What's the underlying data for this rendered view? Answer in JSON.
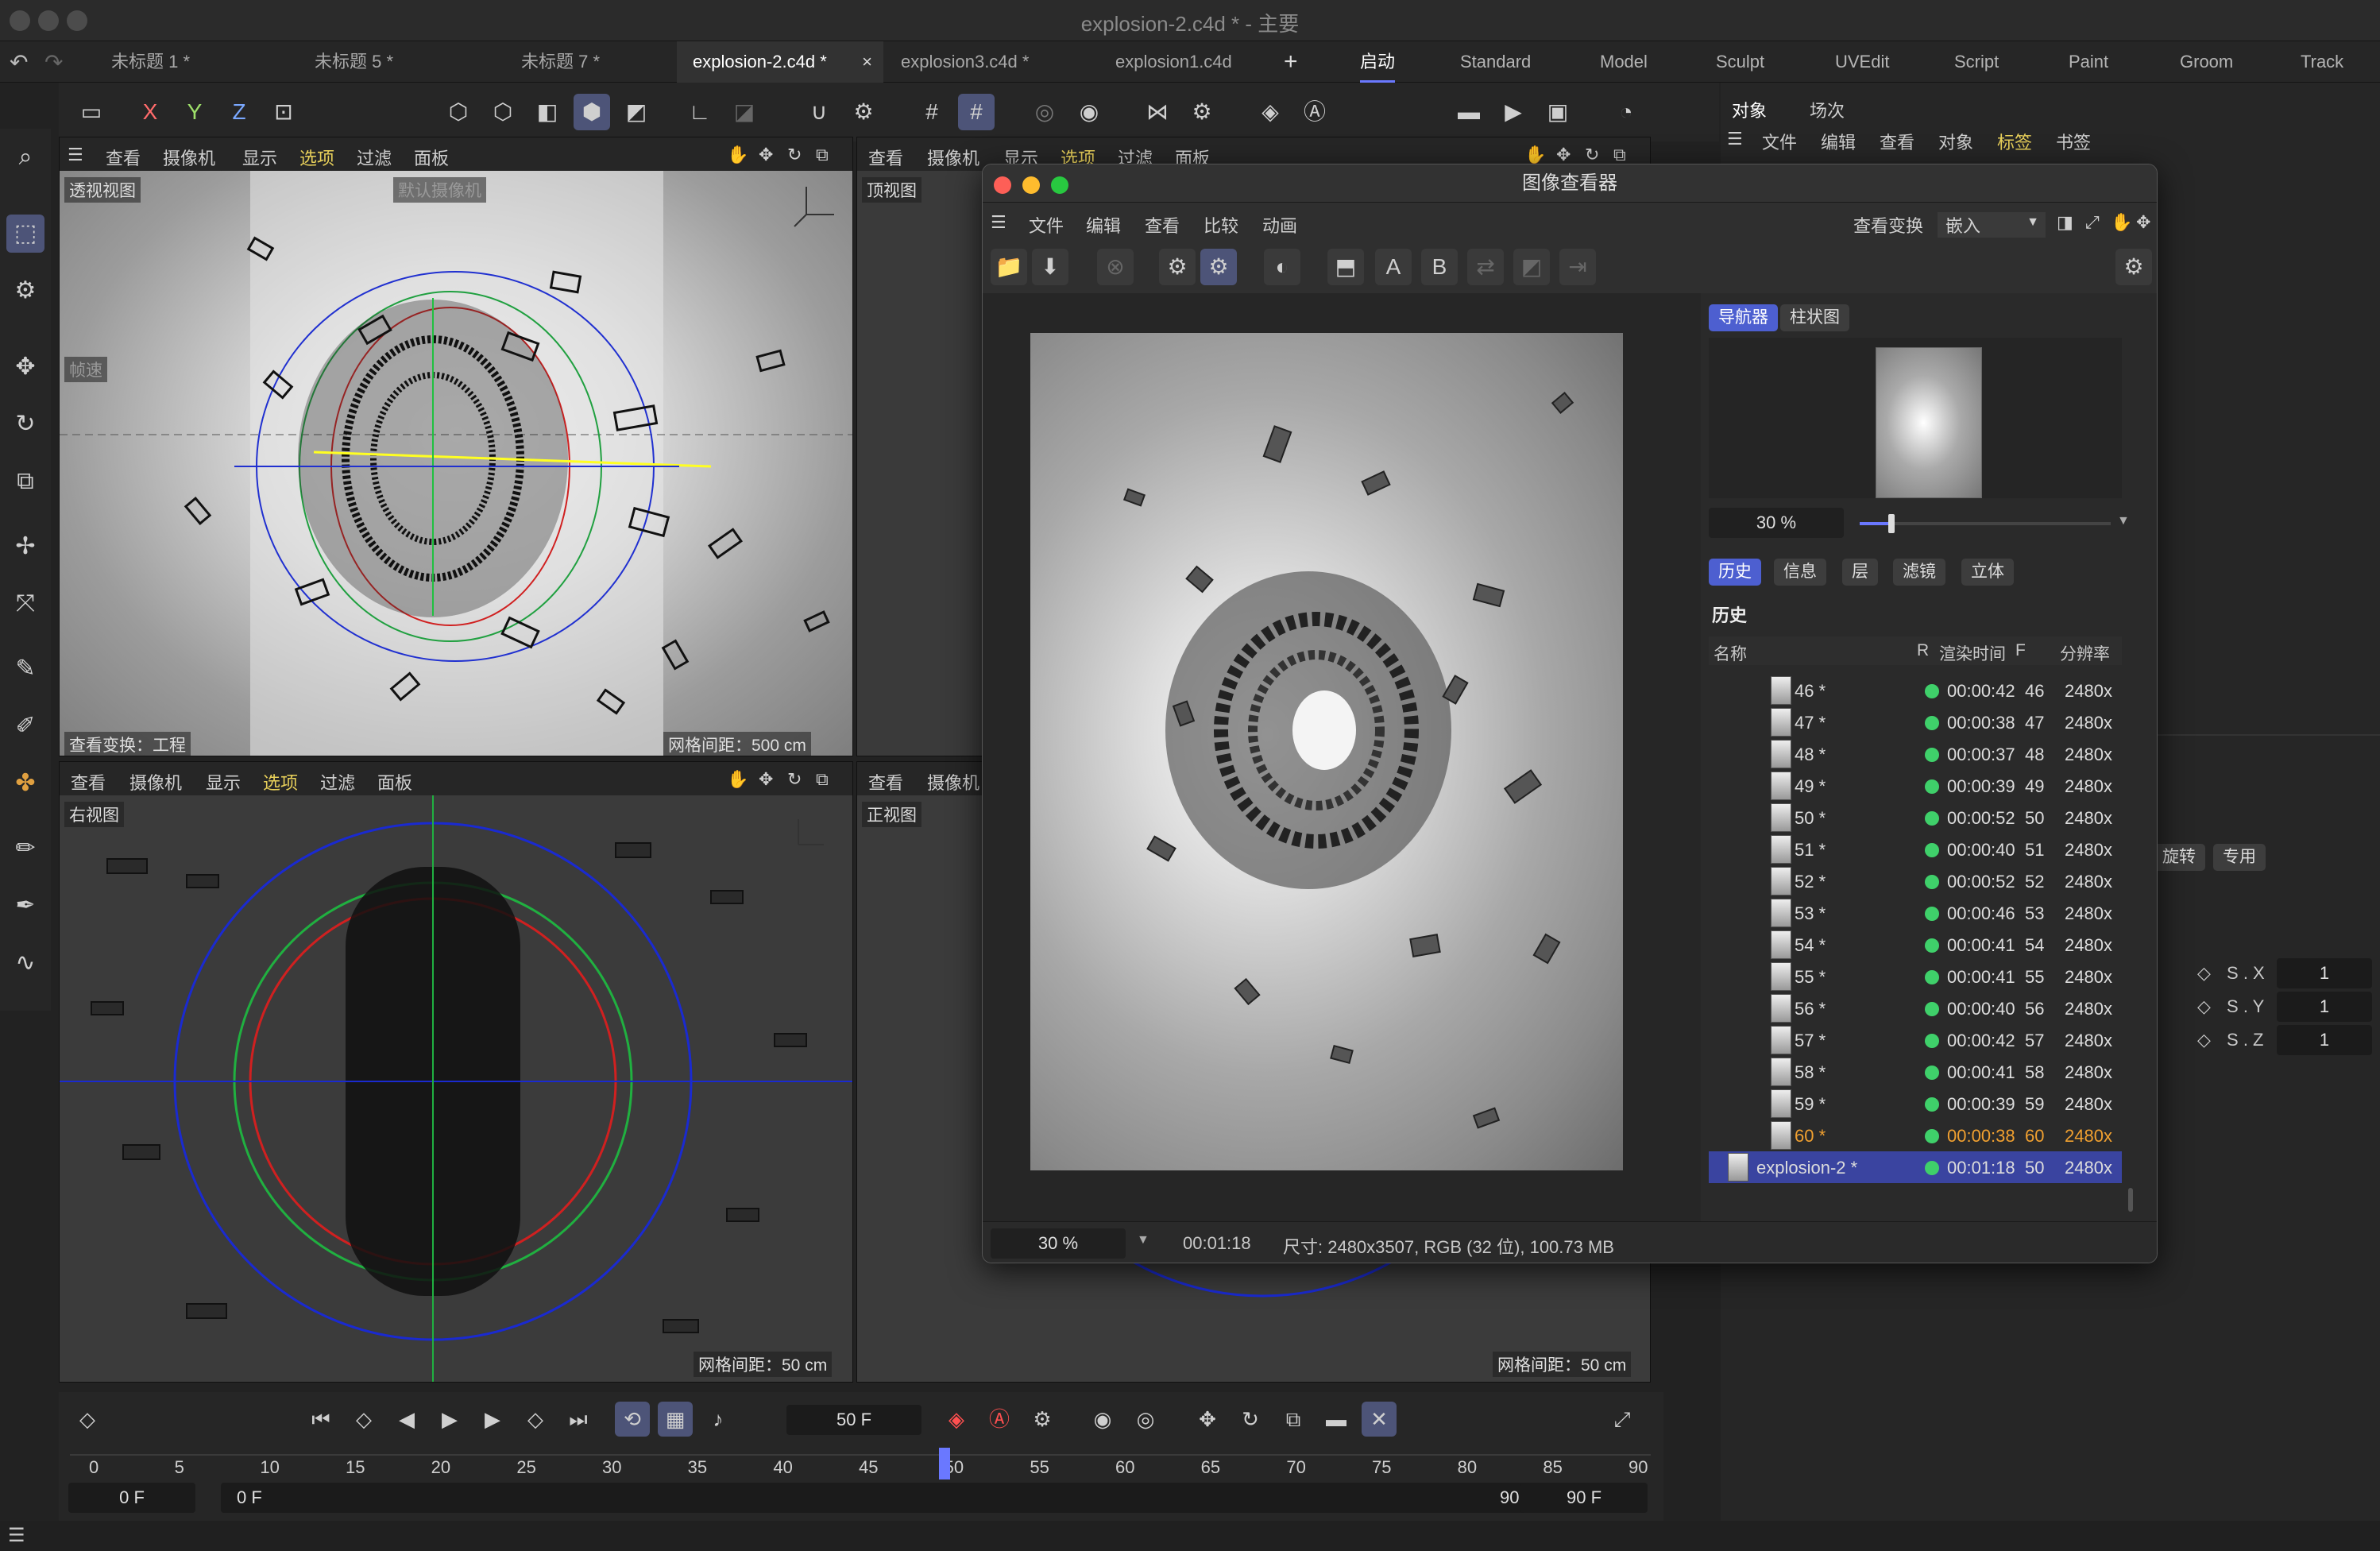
{
  "window": {
    "title": "explosion-2.c4d * - 主要"
  },
  "doc_tabs": [
    {
      "label": "未标题 1 *",
      "active": false
    },
    {
      "label": "未标题 5 *",
      "active": false
    },
    {
      "label": "未标题 7 *",
      "active": false
    },
    {
      "label": "explosion-2.c4d *",
      "active": true
    },
    {
      "label": "explosion3.c4d *",
      "active": false
    },
    {
      "label": "explosion1.c4d",
      "active": false
    }
  ],
  "layouts": [
    "启动",
    "Standard",
    "Model",
    "Sculpt",
    "UVEdit",
    "Script",
    "Paint",
    "Groom",
    "Track"
  ],
  "active_layout": "启动",
  "toolbar": {
    "x": "X",
    "y": "Y",
    "z": "Z"
  },
  "viewport_menu": {
    "view": "查看",
    "camera": "摄像机",
    "display": "显示",
    "options": "选项",
    "filter": "过滤",
    "panel": "面板"
  },
  "viewports": {
    "perspective": {
      "name": "透视视图",
      "cam": "默认摄像机",
      "view_transform": "查看变换：工程",
      "grid": "网格间距：500 cm",
      "hud": "帧速"
    },
    "top": {
      "name": "顶视图"
    },
    "right": {
      "name": "右视图",
      "grid": "网格间距：50 cm"
    },
    "front": {
      "name": "正视图",
      "grid": "网格间距：50 cm"
    }
  },
  "image_viewer": {
    "title": "图像查看器",
    "menus": [
      "文件",
      "编辑",
      "查看",
      "比较",
      "动画"
    ],
    "view_transform_label": "查看变换",
    "view_transform_value": "嵌入",
    "buttons": {
      "a": "A",
      "b": "B"
    },
    "nav_tabs": [
      "导航器",
      "柱状图"
    ],
    "zoom": "30 %",
    "sub_tabs": [
      "历史",
      "信息",
      "层",
      "滤镜",
      "立体"
    ],
    "history_title": "历史",
    "columns": {
      "name": "名称",
      "r": "R",
      "time": "渲染时间",
      "f": "F",
      "res": "分辨率"
    },
    "rows": [
      {
        "name": "46 *",
        "time": "00:00:42",
        "f": "46",
        "res": "2480x"
      },
      {
        "name": "47 *",
        "time": "00:00:38",
        "f": "47",
        "res": "2480x"
      },
      {
        "name": "48 *",
        "time": "00:00:37",
        "f": "48",
        "res": "2480x"
      },
      {
        "name": "49 *",
        "time": "00:00:39",
        "f": "49",
        "res": "2480x"
      },
      {
        "name": "50 *",
        "time": "00:00:52",
        "f": "50",
        "res": "2480x"
      },
      {
        "name": "51 *",
        "time": "00:00:40",
        "f": "51",
        "res": "2480x"
      },
      {
        "name": "52 *",
        "time": "00:00:52",
        "f": "52",
        "res": "2480x"
      },
      {
        "name": "53 *",
        "time": "00:00:46",
        "f": "53",
        "res": "2480x"
      },
      {
        "name": "54 *",
        "time": "00:00:41",
        "f": "54",
        "res": "2480x"
      },
      {
        "name": "55 *",
        "time": "00:00:41",
        "f": "55",
        "res": "2480x"
      },
      {
        "name": "56 *",
        "time": "00:00:40",
        "f": "56",
        "res": "2480x"
      },
      {
        "name": "57 *",
        "time": "00:00:42",
        "f": "57",
        "res": "2480x"
      },
      {
        "name": "58 *",
        "time": "00:00:41",
        "f": "58",
        "res": "2480x"
      },
      {
        "name": "59 *",
        "time": "00:00:39",
        "f": "59",
        "res": "2480x"
      },
      {
        "name": "60 *",
        "time": "00:00:38",
        "f": "60",
        "res": "2480x"
      },
      {
        "name": "explosion-2 *",
        "time": "00:01:18",
        "f": "50",
        "res": "2480x"
      }
    ],
    "status_zoom": "30 %",
    "status_time": "00:01:18",
    "status_info": "尺寸: 2480x3507, RGB (32 位), 100.73 MB"
  },
  "right_panel": {
    "tabs": [
      "对象",
      "场次"
    ],
    "menus": [
      "文件",
      "编辑",
      "查看",
      "对象",
      "标签",
      "书签"
    ],
    "highlight_menu": "标签",
    "attr_buttons": [
      "旋转",
      "专用"
    ],
    "scale_rows": [
      {
        "label": "S . X",
        "value": "1"
      },
      {
        "label": "S . Y",
        "value": "1"
      },
      {
        "label": "S . Z",
        "value": "1"
      }
    ]
  },
  "timeline": {
    "current_frame": "50 F",
    "ticks": [
      "0",
      "5",
      "10",
      "15",
      "20",
      "25",
      "30",
      "35",
      "40",
      "45",
      "50",
      "55",
      "60",
      "65",
      "70",
      "75",
      "80",
      "85",
      "90"
    ],
    "start_a": "0 F",
    "start_b": "0 F",
    "end_a": "90 F",
    "end_b": "90 F"
  },
  "colors": {
    "accent": "#4d5fd0",
    "highlight_yellow": "#e8d05a",
    "history_active_orange": "#f0a030",
    "green_dot": "#3fd06a"
  }
}
